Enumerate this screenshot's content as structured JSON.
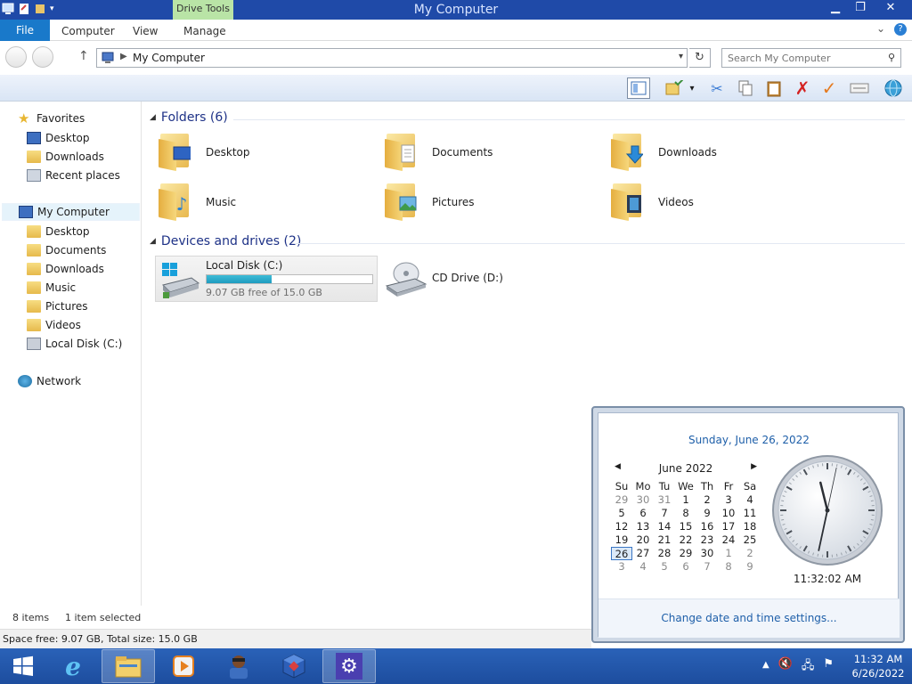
{
  "window": {
    "title": "My Computer",
    "context_tab": "Drive Tools",
    "min_icon": "minimize-icon",
    "max_icon": "restore-icon",
    "close_icon": "close-icon"
  },
  "ribbon": {
    "file_tab": "File",
    "tabs": [
      "Computer",
      "View",
      "Manage"
    ]
  },
  "address": {
    "path": "My Computer",
    "search_placeholder": "Search My Computer"
  },
  "nav": {
    "favorites": "Favorites",
    "fav_items": [
      "Desktop",
      "Downloads",
      "Recent places"
    ],
    "computer": "My Computer",
    "computer_items": [
      "Desktop",
      "Documents",
      "Downloads",
      "Music",
      "Pictures",
      "Videos",
      "Local Disk (C:)"
    ],
    "network": "Network"
  },
  "content": {
    "folders_header": "Folders (6)",
    "folders": [
      "Desktop",
      "Documents",
      "Downloads",
      "Music",
      "Pictures",
      "Videos"
    ],
    "drives_header": "Devices and drives (2)",
    "drive_c": {
      "name": "Local Disk (C:)",
      "free_text": "9.07 GB free of 15.0 GB",
      "used_fraction": 0.395
    },
    "drive_d": {
      "name": "CD Drive (D:)"
    }
  },
  "status": {
    "items": "8 items",
    "selected": "1 item selected",
    "space": "Space free: 9.07 GB, Total size: 15.0 GB"
  },
  "calendar": {
    "long_date": "Sunday, June 26, 2022",
    "month_label": "June 2022",
    "day_headers": [
      "Su",
      "Mo",
      "Tu",
      "We",
      "Th",
      "Fr",
      "Sa"
    ],
    "weeks": [
      [
        "29",
        "30",
        "31",
        "1",
        "2",
        "3",
        "4"
      ],
      [
        "5",
        "6",
        "7",
        "8",
        "9",
        "10",
        "11"
      ],
      [
        "12",
        "13",
        "14",
        "15",
        "16",
        "17",
        "18"
      ],
      [
        "19",
        "20",
        "21",
        "22",
        "23",
        "24",
        "25"
      ],
      [
        "26",
        "27",
        "28",
        "29",
        "30",
        "1",
        "2"
      ],
      [
        "3",
        "4",
        "5",
        "6",
        "7",
        "8",
        "9"
      ]
    ],
    "time": "11:32:02 AM",
    "clock_hour": 11,
    "clock_minute": 32,
    "clock_second": 2,
    "settings_link": "Change date and time settings..."
  },
  "taskbar": {
    "time": "11:32 AM",
    "date": "6/26/2022"
  },
  "colors": {
    "title_bar": "#1f4aa8",
    "accent": "#1979ca",
    "taskbar": "#2a62b8",
    "link": "#1e5fa9"
  }
}
